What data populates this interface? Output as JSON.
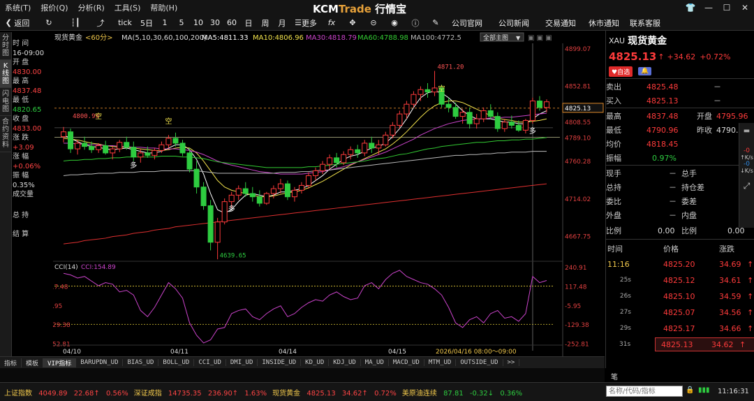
{
  "menu": [
    "系统(T)",
    "报价(Q)",
    "分析(R)",
    "工具(S)",
    "帮助(H)"
  ],
  "brand": {
    "a": "KCM",
    "b": "Trade",
    "c": "行情宝"
  },
  "toolbar": {
    "back": "返回",
    "periods": [
      "tick",
      "5日",
      "1",
      "5",
      "10",
      "30",
      "60",
      "日",
      "周",
      "月"
    ],
    "more": "更多",
    "links": [
      "公司官网",
      "公司新闻",
      "交易通知",
      "休市通知",
      "联系客服"
    ]
  },
  "leftnav": [
    "分时图",
    "K线图",
    "闪电图",
    "合约资料"
  ],
  "info": {
    "time_lbl": "时 间",
    "time": "16-09:00",
    "open_lbl": "开 盘",
    "open": "4830.00",
    "high_lbl": "最 高",
    "high": "4837.48",
    "low_lbl": "最 低",
    "low": "4820.65",
    "close_lbl": "收 盘",
    "close": "4833.00",
    "chg_lbl": "涨 跌",
    "chg": "+3.09",
    "pct_lbl": "涨 幅",
    "pct": "+0.06%",
    "amp_lbl": "振 幅",
    "amp": "0.35%",
    "vol_lbl": "成交量",
    "hold_lbl": "总 持",
    "settle_lbl": "结 算"
  },
  "chart_header": {
    "symbol": "现货黄金",
    "period": "<60分>",
    "ma_label": "MA(5,10,30,60,100,200)",
    "ma5": "MA5:4811.33",
    "ma10": "MA10:4806.96",
    "ma30": "MA30:4818.79",
    "ma60": "MA60:4788.98",
    "ma100": "MA100:4772.5",
    "all_main": "全部主图"
  },
  "chart_data": {
    "type": "candlestick",
    "y_ticks": [
      "4899.07",
      "4852.81",
      "4808.55",
      "4789.10",
      "4760.28",
      "4714.02",
      "4667.75"
    ],
    "current": "4825.13",
    "annotations": {
      "high": "4871.20",
      "low": "4639.65",
      "mark1": "4800.99"
    },
    "signals": [
      "空",
      "空",
      "空",
      "多",
      "多",
      "多",
      "多"
    ],
    "x_labels": [
      "04/10",
      "04/11",
      "04/14",
      "04/15"
    ],
    "cursor_time": "2026/04/16 08:00～09:00",
    "period_label": "60分",
    "cci": {
      "label": "CCI(14)",
      "value": "CCI:154.89",
      "ticks": [
        "240.91",
        "117.48",
        "-5.95",
        "-129.38",
        "-252.81"
      ]
    },
    "candles": [
      [
        4790,
        4802,
        4783,
        4796
      ],
      [
        4796,
        4800,
        4770,
        4775
      ],
      [
        4775,
        4786,
        4768,
        4782
      ],
      [
        4782,
        4790,
        4774,
        4778
      ],
      [
        4778,
        4784,
        4770,
        4774
      ],
      [
        4774,
        4782,
        4770,
        4779
      ],
      [
        4779,
        4785,
        4768,
        4770
      ],
      [
        4770,
        4778,
        4762,
        4775
      ],
      [
        4775,
        4786,
        4771,
        4783
      ],
      [
        4783,
        4790,
        4774,
        4777
      ],
      [
        4777,
        4784,
        4760,
        4765
      ],
      [
        4765,
        4775,
        4758,
        4770
      ],
      [
        4770,
        4778,
        4764,
        4767
      ],
      [
        4767,
        4776,
        4762,
        4773
      ],
      [
        4773,
        4784,
        4770,
        4780
      ],
      [
        4780,
        4792,
        4776,
        4788
      ],
      [
        4788,
        4795,
        4778,
        4782
      ],
      [
        4782,
        4786,
        4766,
        4770
      ],
      [
        4770,
        4776,
        4746,
        4750
      ],
      [
        4750,
        4760,
        4720,
        4728
      ],
      [
        4728,
        4734,
        4700,
        4705
      ],
      [
        4705,
        4712,
        4650,
        4660
      ],
      [
        4660,
        4690,
        4639,
        4685
      ],
      [
        4685,
        4714,
        4682,
        4710
      ],
      [
        4710,
        4722,
        4702,
        4718
      ],
      [
        4718,
        4730,
        4712,
        4726
      ],
      [
        4726,
        4734,
        4716,
        4720
      ],
      [
        4720,
        4728,
        4710,
        4716
      ],
      [
        4716,
        4724,
        4704,
        4708
      ],
      [
        4708,
        4722,
        4706,
        4720
      ],
      [
        4720,
        4730,
        4714,
        4726
      ],
      [
        4726,
        4738,
        4720,
        4732
      ],
      [
        4732,
        4736,
        4712,
        4716
      ],
      [
        4716,
        4728,
        4710,
        4724
      ],
      [
        4724,
        4734,
        4720,
        4730
      ],
      [
        4730,
        4746,
        4726,
        4742
      ],
      [
        4742,
        4752,
        4736,
        4748
      ],
      [
        4748,
        4760,
        4744,
        4756
      ],
      [
        4756,
        4768,
        4750,
        4764
      ],
      [
        4764,
        4770,
        4752,
        4758
      ],
      [
        4758,
        4772,
        4755,
        4768
      ],
      [
        4768,
        4778,
        4762,
        4774
      ],
      [
        4774,
        4780,
        4764,
        4770
      ],
      [
        4770,
        4786,
        4766,
        4782
      ],
      [
        4782,
        4790,
        4770,
        4776
      ],
      [
        4776,
        4786,
        4768,
        4780
      ],
      [
        4780,
        4796,
        4778,
        4792
      ],
      [
        4792,
        4808,
        4788,
        4804
      ],
      [
        4804,
        4822,
        4800,
        4818
      ],
      [
        4818,
        4834,
        4812,
        4830
      ],
      [
        4830,
        4846,
        4826,
        4842
      ],
      [
        4842,
        4852,
        4834,
        4848
      ],
      [
        4848,
        4856,
        4838,
        4845
      ],
      [
        4845,
        4871,
        4840,
        4850
      ],
      [
        4850,
        4854,
        4826,
        4830
      ],
      [
        4830,
        4838,
        4820,
        4826
      ],
      [
        4826,
        4832,
        4812,
        4815
      ],
      [
        4815,
        4824,
        4806,
        4820
      ],
      [
        4820,
        4826,
        4800,
        4806
      ],
      [
        4806,
        4818,
        4800,
        4812
      ],
      [
        4812,
        4826,
        4808,
        4822
      ],
      [
        4822,
        4830,
        4812,
        4815
      ],
      [
        4815,
        4820,
        4796,
        4800
      ],
      [
        4800,
        4812,
        4796,
        4808
      ],
      [
        4808,
        4816,
        4800,
        4804
      ],
      [
        4804,
        4810,
        4796,
        4798
      ],
      [
        4798,
        4812,
        4794,
        4810
      ],
      [
        4810,
        4838,
        4806,
        4834
      ],
      [
        4834,
        4840,
        4822,
        4826
      ],
      [
        4826,
        4836,
        4820,
        4833
      ]
    ],
    "ma_series": {
      "ma5": [
        4792,
        4788,
        4784,
        4780,
        4778,
        4777,
        4775,
        4774,
        4775,
        4776,
        4774,
        4772,
        4770,
        4770,
        4772,
        4776,
        4780,
        4780,
        4774,
        4762,
        4744,
        4720,
        4700,
        4696,
        4700,
        4710,
        4718,
        4720,
        4718,
        4716,
        4718,
        4722,
        4722,
        4724,
        4726,
        4730,
        4736,
        4742,
        4750,
        4756,
        4762,
        4766,
        4768,
        4772,
        4776,
        4778,
        4782,
        4790,
        4800,
        4812,
        4826,
        4838,
        4844,
        4846,
        4844,
        4838,
        4830,
        4822,
        4816,
        4812,
        4812,
        4812,
        4810,
        4808,
        4808,
        4806,
        4806,
        4812,
        4818,
        4822
      ],
      "ma10": [
        4788,
        4787,
        4786,
        4784,
        4782,
        4781,
        4779,
        4778,
        4777,
        4777,
        4776,
        4775,
        4774,
        4773,
        4773,
        4774,
        4776,
        4777,
        4776,
        4770,
        4760,
        4748,
        4736,
        4728,
        4724,
        4722,
        4720,
        4718,
        4716,
        4716,
        4717,
        4719,
        4721,
        4722,
        4724,
        4727,
        4731,
        4735,
        4740,
        4745,
        4750,
        4755,
        4759,
        4763,
        4767,
        4771,
        4775,
        4781,
        4788,
        4796,
        4805,
        4814,
        4822,
        4828,
        4832,
        4834,
        4834,
        4832,
        4828,
        4824,
        4820,
        4816,
        4813,
        4811,
        4810,
        4808,
        4808,
        4809,
        4810,
        4812
      ],
      "ma30": [
        4782,
        4782,
        4781,
        4781,
        4780,
        4780,
        4779,
        4779,
        4778,
        4778,
        4777,
        4777,
        4776,
        4776,
        4775,
        4775,
        4775,
        4774,
        4773,
        4771,
        4768,
        4764,
        4760,
        4757,
        4755,
        4753,
        4751,
        4749,
        4747,
        4746,
        4745,
        4744,
        4744,
        4744,
        4744,
        4745,
        4746,
        4747,
        4749,
        4751,
        4753,
        4756,
        4759,
        4762,
        4765,
        4768,
        4771,
        4775,
        4779,
        4783,
        4787,
        4792,
        4796,
        4800,
        4803,
        4806,
        4808,
        4810,
        4811,
        4812,
        4812,
        4813,
        4813,
        4814,
        4814,
        4815,
        4816,
        4817,
        4818,
        4819
      ],
      "ma60": [
        4760,
        4761,
        4761,
        4762,
        4762,
        4763,
        4763,
        4764,
        4764,
        4765,
        4765,
        4765,
        4765,
        4765,
        4766,
        4766,
        4766,
        4765,
        4765,
        4764,
        4763,
        4761,
        4759,
        4758,
        4757,
        4756,
        4755,
        4754,
        4753,
        4752,
        4752,
        4752,
        4752,
        4752,
        4752,
        4753,
        4753,
        4754,
        4755,
        4756,
        4757,
        4758,
        4759,
        4760,
        4762,
        4763,
        4764,
        4766,
        4768,
        4769,
        4771,
        4773,
        4775,
        4776,
        4778,
        4779,
        4780,
        4781,
        4782,
        4783,
        4783,
        4784,
        4785,
        4785,
        4786,
        4786,
        4787,
        4787,
        4788,
        4789
      ],
      "ma100": [
        4742,
        4743,
        4743,
        4744,
        4744,
        4745,
        4745,
        4745,
        4746,
        4746,
        4746,
        4747,
        4747,
        4747,
        4748,
        4748,
        4748,
        4748,
        4748,
        4748,
        4747,
        4746,
        4745,
        4745,
        4745,
        4745,
        4745,
        4745,
        4745,
        4745,
        4745,
        4746,
        4746,
        4746,
        4747,
        4747,
        4748,
        4749,
        4749,
        4750,
        4751,
        4752,
        4753,
        4754,
        4755,
        4756,
        4757,
        4758,
        4759,
        4760,
        4761,
        4762,
        4763,
        4764,
        4765,
        4766,
        4767,
        4767,
        4768,
        4768,
        4769,
        4769,
        4770,
        4770,
        4771,
        4771,
        4771,
        4772,
        4772,
        4772
      ],
      "ma200": [
        4658,
        4659,
        4660,
        4662,
        4663,
        4664,
        4665,
        4667,
        4668,
        4669,
        4671,
        4672,
        4673,
        4675,
        4676,
        4677,
        4679,
        4680,
        4681,
        4682,
        4683,
        4684,
        4685,
        4686,
        4687,
        4688,
        4689,
        4690,
        4691,
        4692,
        4693,
        4694,
        4695,
        4696,
        4697,
        4698,
        4699,
        4700,
        4701,
        4702,
        4703,
        4704,
        4705,
        4706,
        4707,
        4708,
        4709,
        4710,
        4711,
        4712,
        4713,
        4714,
        4715,
        4716,
        4717,
        4718,
        4719,
        4720,
        4721,
        4722,
        4723,
        4724,
        4725,
        4726,
        4727,
        4728,
        4729,
        4730,
        4731,
        4732
      ]
    },
    "cci_series": [
      200,
      190,
      170,
      180,
      150,
      120,
      140,
      130,
      80,
      90,
      60,
      -40,
      -80,
      -20,
      60,
      140,
      100,
      40,
      -120,
      -200,
      -250,
      -230,
      -160,
      -150,
      -60,
      -40,
      -30,
      -80,
      -100,
      -60,
      -30,
      -10,
      -80,
      -60,
      -20,
      10,
      30,
      20,
      60,
      80,
      50,
      30,
      40,
      120,
      140,
      100,
      160,
      200,
      220,
      180,
      160,
      140,
      130,
      100,
      60,
      -20,
      -120,
      -150,
      -100,
      -80,
      -120,
      -60,
      -40,
      -90,
      -80,
      -110,
      -60,
      180,
      140,
      154
    ],
    "ylim": [
      4640,
      4905
    ],
    "cci_lim": [
      -300,
      260
    ]
  },
  "quote": {
    "code": "XAU",
    "name": "现货黄金",
    "price": "4825.13",
    "chg": "+34.62",
    "pct": "+0.72%",
    "fav": "自选",
    "sell_lbl": "卖出",
    "sell": "4825.48",
    "buy_lbl": "买入",
    "buy": "4825.13",
    "dash": "－",
    "high_lbl": "最高",
    "high": "4837.48",
    "open_lbl": "开盘",
    "open": "4795.96",
    "low_lbl": "最低",
    "low": "4790.96",
    "prev_lbl": "昨收",
    "prev": "4790.",
    "avg_lbl": "均价",
    "avg": "4818.45",
    "amp_lbl": "振幅",
    "amp": "0.97%",
    "cur_lbl": "现手",
    "tot_lbl": "总手",
    "hold_lbl": "总持",
    "hdiff_lbl": "持仓差",
    "wb_lbl": "委比",
    "wc_lbl": "委差",
    "out_lbl": "外盘",
    "in_lbl": "内盘",
    "ratio_lbl": "比例",
    "ratio1": "0.00",
    "ratio2_lbl": "比例",
    "ratio2": "0.00",
    "tick_head": {
      "time": "时间",
      "price": "价格",
      "chg": "涨跌"
    },
    "ticks": [
      {
        "t": "11:16",
        "p": "4825.20",
        "c": "34.69"
      },
      {
        "t": "25s",
        "p": "4825.12",
        "c": "34.61"
      },
      {
        "t": "26s",
        "p": "4825.10",
        "c": "34.59"
      },
      {
        "t": "27s",
        "p": "4825.07",
        "c": "34.56"
      },
      {
        "t": "29s",
        "p": "4825.17",
        "c": "34.66"
      },
      {
        "t": "31s",
        "p": "4825.13",
        "c": "34.62"
      }
    ],
    "side_k": "K/s",
    "side_v": "-0",
    "side_k2": "-0",
    "side_k2b": "K/s"
  },
  "tabs": [
    "指标",
    "模板",
    "VIP指标",
    "BARUPDN_UD",
    "BIAS_UD",
    "BOLL_UD",
    "CCI_UD",
    "DMI_UD",
    "INSIDE_UD",
    "KD_UD",
    "KDJ_UD",
    "MA_UD",
    "MACD_UD",
    "MTM_UD",
    "OUTSIDE_UD",
    ">>"
  ],
  "footer": {
    "label": "笔"
  },
  "status": {
    "items": [
      {
        "n": "上证指数",
        "v": "4049.89",
        "c": "22.68↑",
        "p": "0.56%"
      },
      {
        "n": "深证成指",
        "v": "14735.35",
        "c": "236.90↑",
        "p": "1.63%"
      },
      {
        "n": "现货黄金",
        "v": "4825.13",
        "c": "34.62↑",
        "p": "0.72%"
      },
      {
        "n": "美原油连续",
        "v": "87.81",
        "c": "-0.32↓",
        "p": "0.36%"
      }
    ],
    "search_ph": "名称/代码/指标",
    "clock": "11:16:31"
  },
  "colors": {
    "up": "#ff3b3b",
    "down": "#2ecc40",
    "ma5": "#ffffff",
    "ma10": "#f2e24c",
    "ma30": "#cc44cc",
    "ma60": "#33cc33",
    "ma100": "#bbbbbb",
    "ma200": "#e03030",
    "cci": "#cc44cc"
  }
}
